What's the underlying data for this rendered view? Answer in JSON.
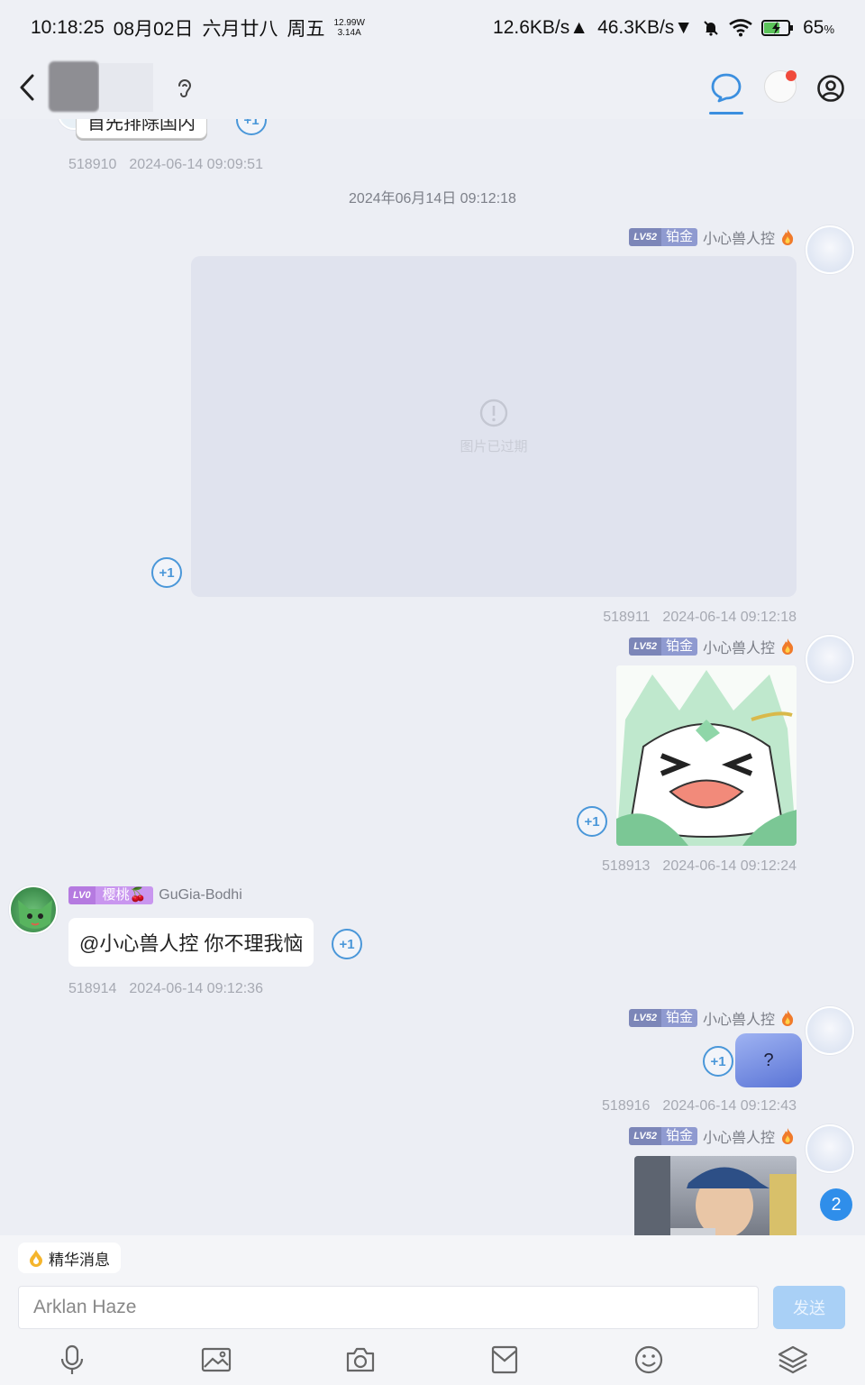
{
  "status_bar": {
    "time": "10:18:25",
    "date": "08月02日",
    "lunar": "六月廿八",
    "weekday": "周五",
    "power_w": "12.99W",
    "current_a": "3.14A",
    "upload": "12.6KB/s▲",
    "download": "46.3KB/s▼",
    "battery": "65",
    "battery_unit": "%"
  },
  "messages": {
    "top_partial": {
      "text": "首先排除国内",
      "id": "518910",
      "time": "2024-06-14 09:09:51"
    },
    "divider_time": "2024年06月14日 09:12:18",
    "msg1": {
      "level": "LV52",
      "rank": "铂金",
      "name": "小心兽人控",
      "expired_text": "图片已过期",
      "id": "518911",
      "time": "2024-06-14 09:12:18"
    },
    "msg2": {
      "level": "LV52",
      "rank": "铂金",
      "name": "小心兽人控",
      "id": "518913",
      "time": "2024-06-14 09:12:24"
    },
    "msg3": {
      "level": "LV0",
      "rank": "樱桃🍒",
      "name": "GuGia-Bodhi",
      "text": "@小心兽人控 你不理我恼",
      "id": "518914",
      "time": "2024-06-14 09:12:36"
    },
    "msg4": {
      "level": "LV52",
      "rank": "铂金",
      "name": "小心兽人控",
      "sticker_text": "?",
      "id": "518916",
      "time": "2024-06-14 09:12:43"
    },
    "msg5": {
      "level": "LV52",
      "rank": "铂金",
      "name": "小心兽人控"
    },
    "plus_one": "+1"
  },
  "unread_count": "2",
  "bottom": {
    "featured_label": "精华消息",
    "input_value": "Arklan Haze",
    "send_label": "发送"
  },
  "colors": {
    "accent": "#3b8fdf",
    "background": "#eceef4",
    "send_button": "#a9d0f6"
  }
}
